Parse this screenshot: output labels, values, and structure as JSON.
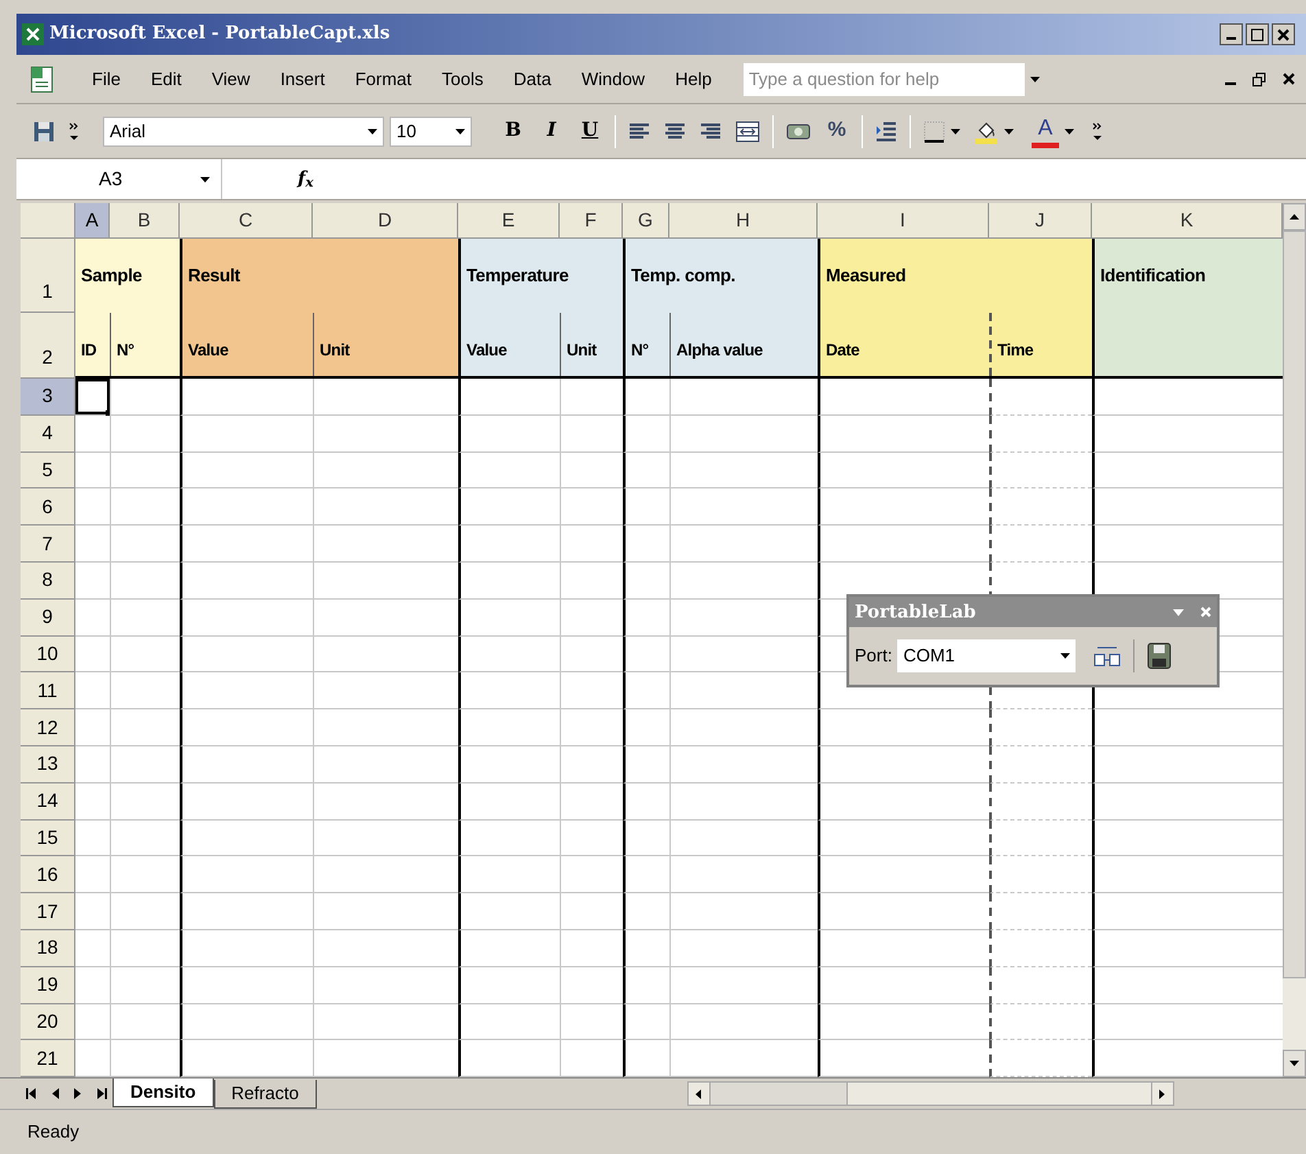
{
  "window": {
    "title": "Microsoft Excel - PortableCapt.xls"
  },
  "menu": [
    {
      "label": "File"
    },
    {
      "label": "Edit"
    },
    {
      "label": "View"
    },
    {
      "label": "Insert"
    },
    {
      "label": "Format"
    },
    {
      "label": "Tools"
    },
    {
      "label": "Data"
    },
    {
      "label": "Window"
    },
    {
      "label": "Help"
    }
  ],
  "help_search": {
    "placeholder": "Type a question for help"
  },
  "toolbar": [
    {
      "kind": "save"
    },
    {
      "kind": "more"
    },
    {
      "kind": "font",
      "label": "Arial"
    },
    {
      "kind": "size",
      "label": "10"
    },
    {
      "kind": "bold",
      "label": "B"
    },
    {
      "kind": "italic",
      "label": "I"
    },
    {
      "kind": "underline",
      "label": "U"
    },
    {
      "kind": "separator"
    },
    {
      "kind": "align-left"
    },
    {
      "kind": "align-center"
    },
    {
      "kind": "align-right"
    },
    {
      "kind": "merge"
    },
    {
      "kind": "separator"
    },
    {
      "kind": "currency"
    },
    {
      "kind": "percent",
      "label": "%"
    },
    {
      "kind": "separator"
    },
    {
      "kind": "indent"
    },
    {
      "kind": "separator"
    },
    {
      "kind": "borders"
    },
    {
      "kind": "fill-color"
    },
    {
      "kind": "font-color",
      "label": "A"
    },
    {
      "kind": "more"
    }
  ],
  "formula_bar": {
    "name_box": "A3",
    "function_label": "f$_{x}$"
  },
  "columns": [
    {
      "letter": "A",
      "selected": true,
      "page_break": false
    },
    {
      "letter": "B",
      "selected": false,
      "page_break": false
    },
    {
      "letter": "C",
      "selected": false,
      "page_break": false
    },
    {
      "letter": "D",
      "selected": false,
      "page_break": false
    },
    {
      "letter": "E",
      "selected": false,
      "page_break": false
    },
    {
      "letter": "F",
      "selected": false,
      "page_break": false
    },
    {
      "letter": "G",
      "selected": false,
      "page_break": false
    },
    {
      "letter": "H",
      "selected": false,
      "page_break": false
    },
    {
      "letter": "I",
      "selected": false,
      "page_break": false
    },
    {
      "letter": "J",
      "selected": false,
      "page_break": true
    },
    {
      "letter": "K",
      "selected": false,
      "page_break": false
    }
  ],
  "header_groups": [
    {
      "label": "Sample",
      "color": "#fdf7d2",
      "subheaders": [
        {
          "label": "ID"
        },
        {
          "label": "N°"
        }
      ]
    },
    {
      "label": "Result",
      "color": "#f2c58f",
      "subheaders": [
        {
          "label": "Value"
        },
        {
          "label": "Unit"
        }
      ]
    },
    {
      "label": "Temperature",
      "color": "#dde9ee",
      "subheaders": [
        {
          "label": "Value"
        },
        {
          "label": "Unit"
        }
      ]
    },
    {
      "label": "Temp. comp.",
      "color": "#dde9ee",
      "subheaders": [
        {
          "label": "N°"
        },
        {
          "label": "Alpha value"
        }
      ]
    },
    {
      "label": "Measured",
      "color": "#f8ee9c",
      "subheaders": [
        {
          "label": "Date"
        },
        {
          "label": "Time"
        }
      ]
    },
    {
      "label": "Identification",
      "color": "#dbe8d4"
    }
  ],
  "rows": [
    {
      "number": "1",
      "selected": false
    },
    {
      "number": "2",
      "selected": false
    },
    {
      "number": "3",
      "selected": true
    },
    {
      "number": "4",
      "selected": false
    },
    {
      "number": "5",
      "selected": false
    },
    {
      "number": "6",
      "selected": false
    },
    {
      "number": "7",
      "selected": false
    },
    {
      "number": "8",
      "selected": false
    },
    {
      "number": "9",
      "selected": false
    },
    {
      "number": "10",
      "selected": false
    },
    {
      "number": "11",
      "selected": false
    },
    {
      "number": "12",
      "selected": false
    },
    {
      "number": "13",
      "selected": false
    },
    {
      "number": "14",
      "selected": false
    },
    {
      "number": "15",
      "selected": false
    },
    {
      "number": "16",
      "selected": false
    },
    {
      "number": "17",
      "selected": false
    },
    {
      "number": "18",
      "selected": false
    },
    {
      "number": "19",
      "selected": false
    },
    {
      "number": "20",
      "selected": false
    },
    {
      "number": "21",
      "selected": false
    }
  ],
  "floating_toolbar": {
    "title": "PortableLab",
    "port_label": "Port:",
    "port_value": "COM1"
  },
  "sheet_tabs": [
    {
      "label": "Densito",
      "selected": true
    },
    {
      "label": "Refracto",
      "selected": false
    }
  ],
  "status_bar": {
    "text": "Ready"
  }
}
